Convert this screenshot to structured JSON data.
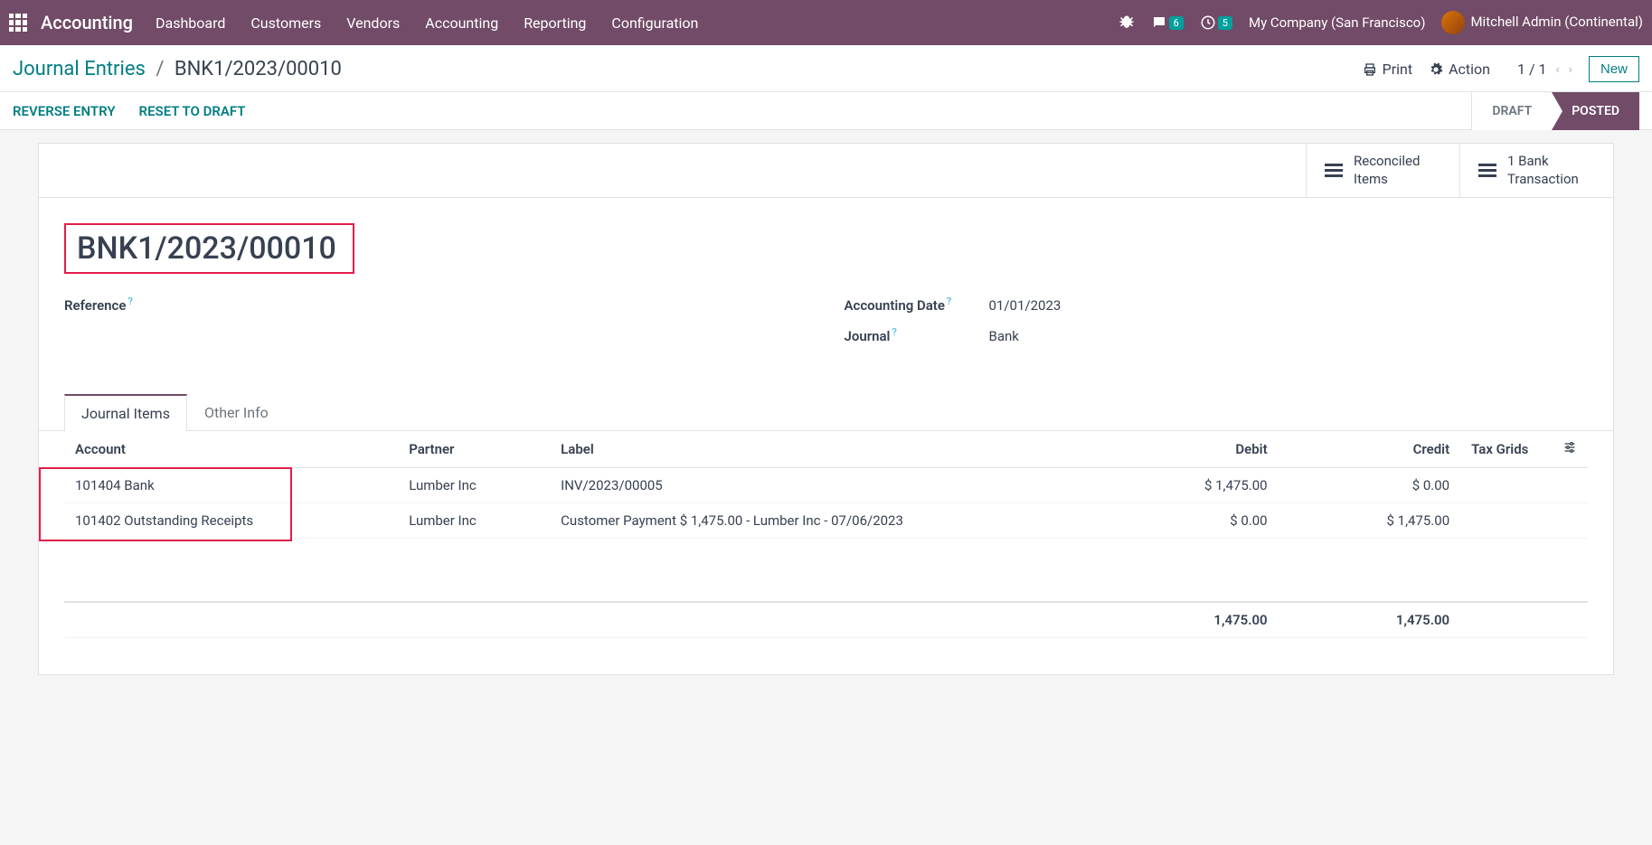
{
  "nav": {
    "brand": "Accounting",
    "menu": [
      "Dashboard",
      "Customers",
      "Vendors",
      "Accounting",
      "Reporting",
      "Configuration"
    ],
    "chat_badge": "6",
    "clock_badge": "5",
    "company": "My Company (San Francisco)",
    "user": "Mitchell Admin (Continental)"
  },
  "header": {
    "breadcrumb_root": "Journal Entries",
    "breadcrumb_current": "BNK1/2023/00010",
    "print": "Print",
    "action": "Action",
    "pager": "1 / 1",
    "new_btn": "New"
  },
  "actions": {
    "reverse": "REVERSE ENTRY",
    "reset": "RESET TO DRAFT",
    "status_draft": "DRAFT",
    "status_posted": "POSTED"
  },
  "stats": {
    "reconciled_l1": "Reconciled",
    "reconciled_l2": "Items",
    "bank_l1": "1 Bank",
    "bank_l2": "Transaction"
  },
  "entry": {
    "title": "BNK1/2023/00010",
    "ref_label": "Reference",
    "date_label": "Accounting Date",
    "date_value": "01/01/2023",
    "journal_label": "Journal",
    "journal_value": "Bank"
  },
  "tabs": {
    "items": "Journal Items",
    "other": "Other Info"
  },
  "table": {
    "cols": {
      "account": "Account",
      "partner": "Partner",
      "label": "Label",
      "debit": "Debit",
      "credit": "Credit",
      "tax": "Tax Grids"
    },
    "rows": [
      {
        "account": "101404 Bank",
        "partner": "Lumber Inc",
        "label": "INV/2023/00005",
        "debit": "$ 1,475.00",
        "credit": "$ 0.00"
      },
      {
        "account": "101402 Outstanding Receipts",
        "partner": "Lumber Inc",
        "label": "Customer Payment $ 1,475.00 - Lumber Inc - 07/06/2023",
        "debit": "$ 0.00",
        "credit": "$ 1,475.00"
      }
    ],
    "totals": {
      "debit": "1,475.00",
      "credit": "1,475.00"
    }
  }
}
